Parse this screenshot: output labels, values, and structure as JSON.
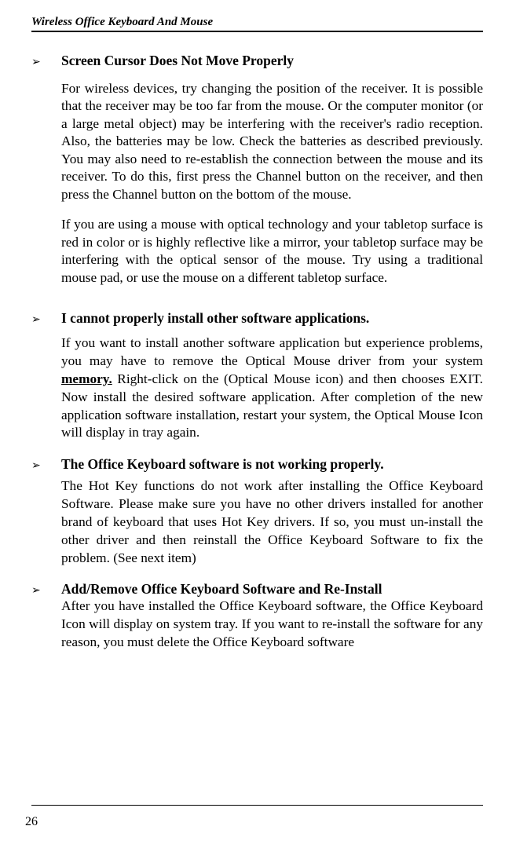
{
  "header": "Wireless Office Keyboard And Mouse",
  "sections": {
    "s1": {
      "heading": "Screen Cursor Does Not Move Properly",
      "p1": "For wireless devices, try changing the position of the receiver. It is possible that the receiver may be too far from the mouse. Or the computer monitor (or a large metal object) may be interfering with the receiver's radio reception. Also, the batteries may be low. Check the batteries as described previously. You may also need to re-establish the connection between the mouse and its receiver. To do this, first press the Channel button on the receiver, and then press the Channel button on the bottom of the mouse.",
      "p2": "If you are using a mouse with optical technology and your tabletop surface is red in color or is highly reflective like a mirror, your tabletop surface may be interfering with the optical sensor of the mouse. Try using a traditional mouse pad, or use the mouse on a different tabletop surface."
    },
    "s2": {
      "heading": "I cannot properly install other software applications.",
      "p1a": "If you want to install another software application but experience problems, you may have to remove the Optical Mouse driver from your system ",
      "p1b": "memory.",
      "p1c": "   Right-click on the (Optical Mouse icon) and then chooses EXIT. Now install the desired software application. After completion of the new application software installation, restart your system, the Optical Mouse Icon will display in tray again."
    },
    "s3": {
      "heading": "The Office Keyboard software is not working properly.",
      "p1": "The Hot Key functions do not work after installing the Office Keyboard Software. Please make sure you have no other drivers installed for another brand of keyboard that uses Hot Key drivers. If so, you must un-install the other driver and then reinstall the Office Keyboard Software to fix the problem.  (See next item)"
    },
    "s4": {
      "heading": "Add/Remove Office Keyboard Software and Re-Install",
      "p1": "After you have installed the Office Keyboard software, the Office Keyboard Icon will display on system tray. If you want to re-install the software for any reason, you must delete the Office Keyboard software"
    }
  },
  "pageNumber": "26"
}
